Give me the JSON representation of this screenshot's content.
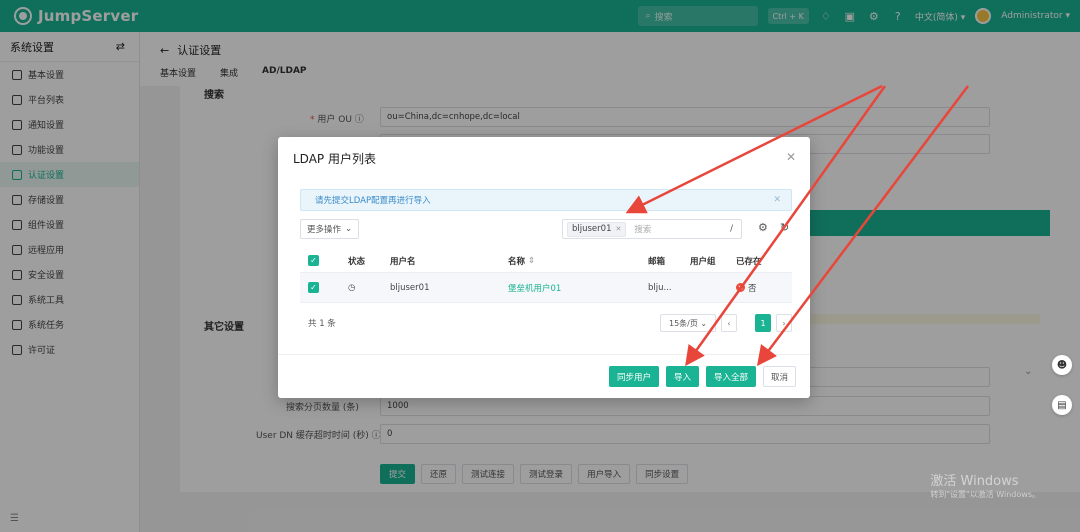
{
  "brand": {
    "name": "JumpServer"
  },
  "topbar": {
    "search_placeholder": "搜索",
    "shortcut": "Ctrl + K",
    "language": "中文(简体)",
    "user": "Administrator",
    "icons": [
      "bell-icon",
      "message-icon",
      "settings-icon",
      "help-icon"
    ]
  },
  "sidebar": {
    "title": "系统设置",
    "items": [
      {
        "label": "基本设置",
        "active": false
      },
      {
        "label": "平台列表",
        "active": false
      },
      {
        "label": "通知设置",
        "active": false
      },
      {
        "label": "功能设置",
        "active": false
      },
      {
        "label": "认证设置",
        "active": true
      },
      {
        "label": "存储设置",
        "active": false
      },
      {
        "label": "组件设置",
        "active": false
      },
      {
        "label": "远程应用",
        "active": false
      },
      {
        "label": "安全设置",
        "active": false
      },
      {
        "label": "系统工具",
        "active": false
      },
      {
        "label": "系统任务",
        "active": false
      },
      {
        "label": "许可证",
        "active": false
      }
    ]
  },
  "page": {
    "title": "认证设置",
    "tabs": [
      {
        "label": "基本设置",
        "active": false
      },
      {
        "label": "集成",
        "active": false
      },
      {
        "label": "AD/LDAP",
        "active": true
      }
    ]
  },
  "form": {
    "section_search": "搜索",
    "user_ou_label": "用户 OU",
    "user_ou_value": "ou=China,dc=cnhope,dc=local",
    "section_other": "其它设置",
    "page_size_label": "搜索分页数量 (条)",
    "page_size_value": "1000",
    "cache_label": "User DN 缓存超时时间 (秒)",
    "cache_value": "0",
    "buttons": [
      "提交",
      "还原",
      "测试连接",
      "测试登录",
      "用户导入",
      "同步设置"
    ]
  },
  "modal": {
    "title": "LDAP 用户列表",
    "alert": "请先提交LDAP配置再进行导入",
    "more_actions": "更多操作",
    "search_tag": "bljuser01",
    "search_placeholder": "搜索",
    "search_slash": "/",
    "columns": [
      "状态",
      "用户名",
      "名称",
      "邮箱",
      "用户组",
      "已存在"
    ],
    "rows": [
      {
        "username": "bljuser01",
        "name": "堡垒机用户01",
        "email": "blju...",
        "groups": "",
        "exists": "否"
      }
    ],
    "total": "共 1 条",
    "page_size": "15条/页",
    "current_page": "1",
    "buttons": {
      "sync": "同步用户",
      "import": "导入",
      "import_all": "导入全部",
      "cancel": "取消"
    }
  },
  "watermark": {
    "title": "激活 Windows",
    "subtitle": "转到\"设置\"以激活 Windows。"
  },
  "colors": {
    "brand": "#1ab394",
    "danger": "#e74c3c",
    "arrow": "#e8463b"
  }
}
